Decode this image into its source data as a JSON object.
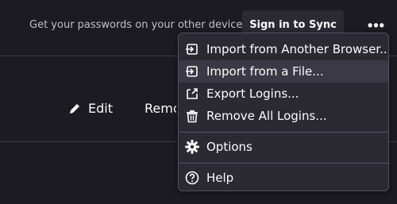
{
  "header": {
    "sync_prompt": "Get your passwords on your other devices",
    "sign_in_button": "Sign in to Sync",
    "more_button": "•••"
  },
  "login_actions": {
    "edit_label": "Edit",
    "remove_label": "Remove"
  },
  "menu": {
    "items": [
      {
        "label": "Import from Another Browser...",
        "icon": "import-icon"
      },
      {
        "label": "Import from a File...",
        "icon": "import-icon",
        "highlighted": true
      },
      {
        "label": "Export Logins...",
        "icon": "export-icon"
      },
      {
        "label": "Remove All Logins...",
        "icon": "trash-icon"
      },
      {
        "label": "Options",
        "icon": "gear-icon"
      },
      {
        "label": "Help",
        "icon": "help-icon"
      }
    ]
  },
  "colors": {
    "background": "#1c1b22",
    "menu_background": "#2b2a33",
    "menu_hover": "#3a3944",
    "text": "#fbfbfe",
    "muted_text": "#bfbfc9"
  }
}
